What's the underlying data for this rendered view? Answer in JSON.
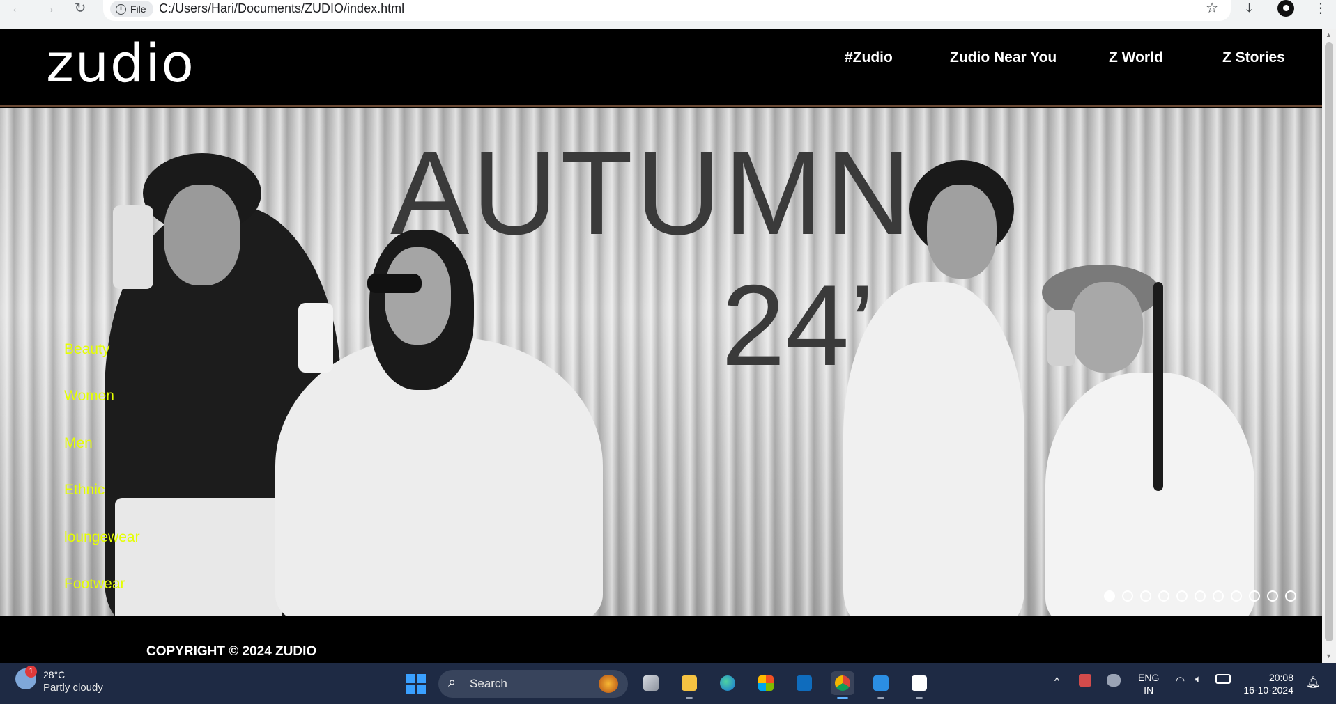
{
  "browser": {
    "back_icon": "arrow-left-icon",
    "forward_icon": "arrow-right-icon",
    "reload_icon": "reload-icon",
    "site_chip_label": "File",
    "url": "C:/Users/Hari/Documents/ZUDIO/index.html",
    "bookmark_icon": "star-icon",
    "download_icon": "download-icon",
    "menu_icon": "kebab-menu-icon"
  },
  "site": {
    "logo": "zudio",
    "nav": [
      "#Zudio",
      "Zudio Near You",
      "Z World",
      "Z Stories"
    ],
    "hero": {
      "line1": "AUTUMN",
      "line2": "24’"
    },
    "side_menu": [
      "Beauty",
      "Women",
      "Men",
      "Ethnic",
      "loungewear",
      "Footwear"
    ],
    "carousel": {
      "total_slides": 11,
      "active_index": 0
    },
    "footer": {
      "copyright": "COPYRIGHT © 2024 ZUDIO"
    },
    "colors": {
      "side_menu": "#e5ff00",
      "header_bg": "#000000",
      "header_border": "#6b4a35"
    }
  },
  "taskbar": {
    "weather": {
      "badge": "1",
      "temp": "28°C",
      "desc": "Partly cloudy"
    },
    "search_placeholder": "Search",
    "apps": [
      "task-view",
      "file-explorer",
      "edge",
      "microsoft-store",
      "outlook",
      "chrome",
      "vs-code",
      "snipping-tool"
    ],
    "active_app": "chrome",
    "lang": {
      "line1": "ENG",
      "line2": "IN"
    },
    "time": "20:08",
    "date": "16-10-2024"
  }
}
